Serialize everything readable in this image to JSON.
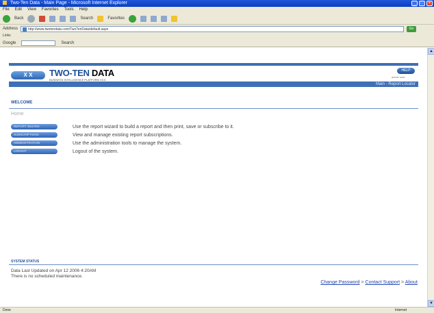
{
  "browser": {
    "title": "Two-Ten Data - Main Page - Microsoft Internet Explorer",
    "menu": [
      "File",
      "Edit",
      "View",
      "Favorites",
      "Tools",
      "Help"
    ],
    "toolbar": {
      "back": "Back",
      "search": "Search",
      "favorites": "Favorites"
    },
    "address_label": "Address",
    "address_url": "http://www.twotendata.com/TwoTenData/default.aspx",
    "go": "Go",
    "links": "Links",
    "google_label": "Google",
    "google_search": "Search",
    "status_left": "Done",
    "status_zone": "Internet"
  },
  "app": {
    "logo_mark": "X X",
    "logo_title_a": "TWO-TEN",
    "logo_title_b": "DATA",
    "logo_sub": "BUSINESS INTELLIGENCE PLATFORM V3.0",
    "help": "HELP",
    "user": "admin user",
    "bar_right": "Main - Report Locator"
  },
  "welcome": {
    "title": "WELCOME",
    "home": "Home",
    "menu": [
      {
        "button": "REPORT WIZARD",
        "desc": "Use the report wizard to build a report and then print, save or subscribe to it."
      },
      {
        "button": "SUBSCRIPTIONS",
        "desc": "View and manage existing report subscriptions."
      },
      {
        "button": "ADMINISTRATION",
        "desc": "Use the administration tools to manage the system."
      },
      {
        "button": "LOGOUT",
        "desc": "Logout of the system."
      }
    ]
  },
  "system_status": {
    "title": "SYSTEM STATUS",
    "data_updated": "Data Last Updated on Apr 12 2006 4:20AM",
    "maintenance": "There is no scheduled maintenance."
  },
  "footer": {
    "change_password": "Change Password",
    "sep": " > ",
    "contact_support": "Contact Support",
    "about": "About"
  }
}
